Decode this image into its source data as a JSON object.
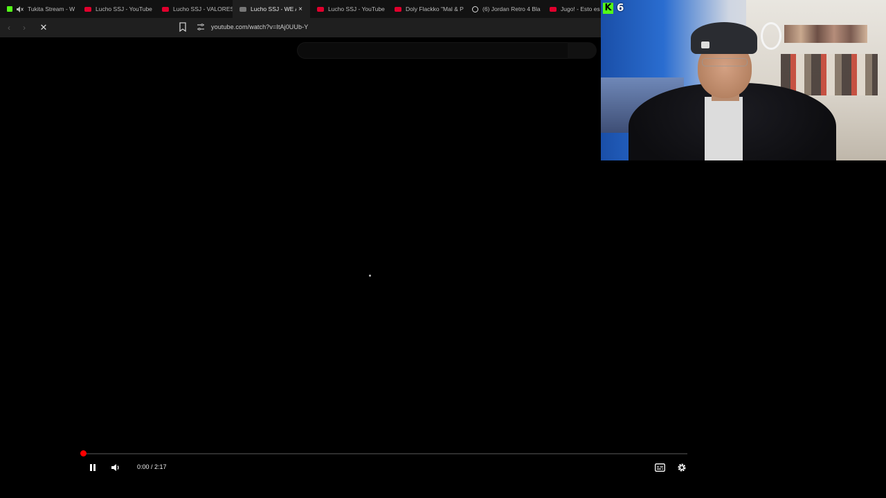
{
  "tabs": [
    {
      "title": "Tukita Stream - W",
      "favicon": "kick-icon",
      "muted": true,
      "active": false
    },
    {
      "title": "Lucho SSJ - YouTube",
      "favicon": "youtube-icon",
      "active": false
    },
    {
      "title": "Lucho SSJ - VALORES",
      "favicon": "youtube-icon",
      "active": false
    },
    {
      "title": "Lucho SSJ - WE AR",
      "favicon": "youtube-icon",
      "active": true,
      "close": "×"
    },
    {
      "title": "Lucho SSJ - YouTube",
      "favicon": "youtube-icon",
      "active": false
    },
    {
      "title": "Doly Flackko \"Mal & P",
      "favicon": "youtube-icon",
      "active": false
    },
    {
      "title": "(6) Jordan Retro 4 Bla",
      "favicon": "globe-icon",
      "active": false
    },
    {
      "title": "Jugo! - Esto es tra",
      "favicon": "youtube-icon",
      "active": false
    }
  ],
  "toolbar": {
    "url": "youtube.com/watch?v=ItAj0UUb-Y"
  },
  "player": {
    "current_time": "0:00",
    "separator": " / ",
    "duration": "2:17",
    "progress": 0.0
  },
  "overlay": {
    "platform_logo": "K",
    "viewer_count": "6"
  },
  "colors": {
    "accent_progress": "#ff0000",
    "kick_green": "#53fc18",
    "youtube_red": "#e1002d"
  }
}
